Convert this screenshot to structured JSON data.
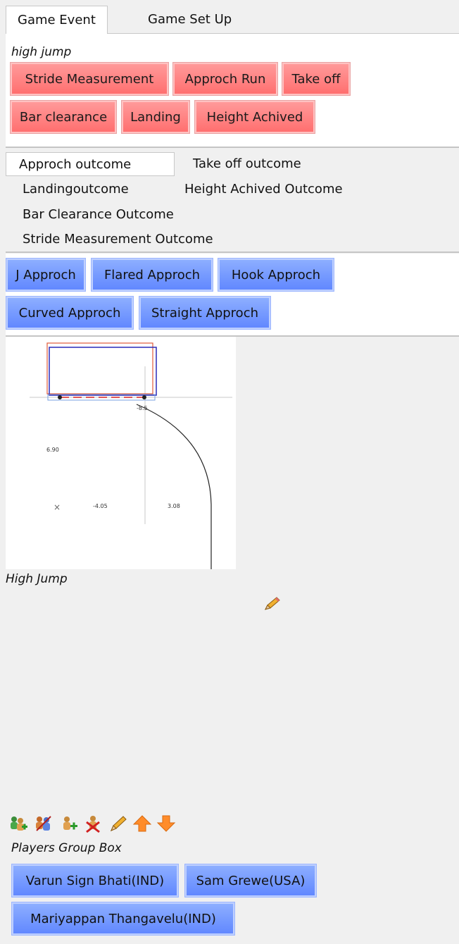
{
  "tabs": [
    {
      "label": "Game Event",
      "active": true
    },
    {
      "label": "Game Set Up",
      "active": false
    }
  ],
  "event_group": {
    "title": "high jump",
    "buttons": [
      "Stride Measurement",
      "Approch Run",
      "Take off",
      "Bar clearance",
      "Landing",
      "Height Achived"
    ],
    "color": "#ff7a7a"
  },
  "outcome_tabs": [
    {
      "label": "Approch outcome",
      "active": true
    },
    {
      "label": "Take off outcome",
      "active": false
    },
    {
      "label": "Landingoutcome",
      "active": false
    },
    {
      "label": "Height Achived Outcome",
      "active": false
    },
    {
      "label": "Bar Clearance Outcome",
      "active": false
    },
    {
      "label": "Stride Measurement Outcome",
      "active": false
    }
  ],
  "approach_buttons": [
    "J Approch",
    "Flared Approch",
    "Hook Approch",
    "Curved Approch",
    "Straight Approch"
  ],
  "diagram": {
    "labels": [
      "-8.5",
      "6.90",
      "-4.05",
      "3.08"
    ],
    "marker": "×"
  },
  "section_label": "High Jump",
  "toolbar_icons": [
    "add-group-icon",
    "group-settings-icon",
    "add-player-icon",
    "remove-player-icon",
    "edit-pencil-icon",
    "arrow-up-icon",
    "arrow-down-icon"
  ],
  "players_group": {
    "title": "Players Group Box",
    "players": [
      "Varun Sign Bhati(IND)",
      "Sam Grewe(USA)",
      "Mariyappan Thangavelu(IND)"
    ],
    "color": "#6f93ff"
  }
}
